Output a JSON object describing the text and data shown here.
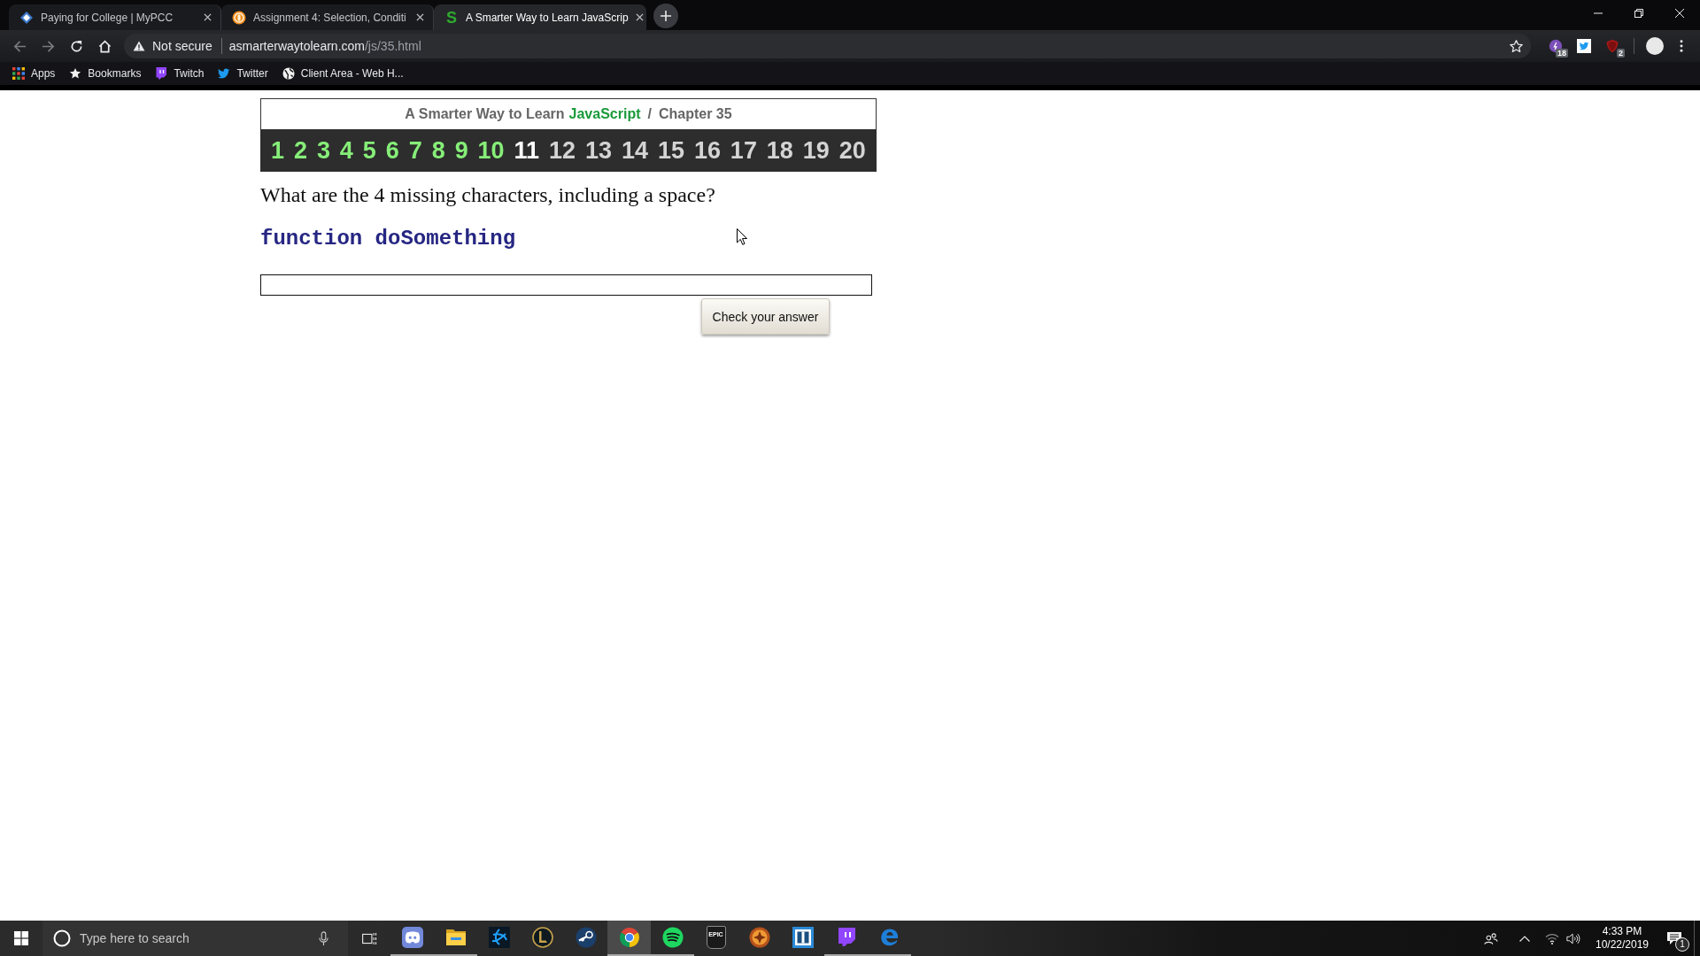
{
  "browser": {
    "tabs": [
      {
        "kind": "diamond",
        "title": "Paying for College | MyPCC",
        "selected": false
      },
      {
        "kind": "medal",
        "title": "Assignment 4: Selection, Conditi",
        "selected": false
      },
      {
        "kind": "letter",
        "icon_text": "S",
        "title": "A Smarter Way to Learn JavaScrip",
        "selected": true
      }
    ],
    "toolbar": {
      "back_disabled": true,
      "forward_disabled": true
    },
    "address_bar": {
      "security_label": "Not secure",
      "host": "asmarterwaytolearn.com",
      "path": "/js/35.html",
      "bookmarked": false
    },
    "extensions": [
      {
        "kind": "orb",
        "badge": "18"
      },
      {
        "kind": "bird"
      },
      {
        "kind": "shield",
        "badge": "2"
      }
    ],
    "bookmarks": [
      {
        "kind": "apps",
        "label": "Apps"
      },
      {
        "kind": "star",
        "label": "Bookmarks"
      },
      {
        "kind": "bubble",
        "label": "Twitch"
      },
      {
        "kind": "bird",
        "label": "Twitter"
      },
      {
        "kind": "globe",
        "label": "Client Area - Web H..."
      }
    ]
  },
  "page": {
    "site_title": {
      "prefix": "A Smarter Way to Learn",
      "highlight": "JavaScript",
      "separator": "/",
      "chapter": "Chapter 35"
    },
    "exercises": [
      {
        "label": "1",
        "done": true,
        "selected": false
      },
      {
        "label": "2",
        "done": true,
        "selected": false
      },
      {
        "label": "3",
        "done": true,
        "selected": false
      },
      {
        "label": "4",
        "done": true,
        "selected": false
      },
      {
        "label": "5",
        "done": true,
        "selected": false
      },
      {
        "label": "6",
        "done": true,
        "selected": false
      },
      {
        "label": "7",
        "done": true,
        "selected": false
      },
      {
        "label": "8",
        "done": true,
        "selected": false
      },
      {
        "label": "9",
        "done": true,
        "selected": false
      },
      {
        "label": "10",
        "done": true,
        "selected": false
      },
      {
        "label": "11",
        "done": false,
        "selected": true
      },
      {
        "label": "12",
        "done": false,
        "selected": false
      },
      {
        "label": "13",
        "done": false,
        "selected": false
      },
      {
        "label": "14",
        "done": false,
        "selected": false
      },
      {
        "label": "15",
        "done": false,
        "selected": false
      },
      {
        "label": "16",
        "done": false,
        "selected": false
      },
      {
        "label": "17",
        "done": false,
        "selected": false
      },
      {
        "label": "18",
        "done": false,
        "selected": false
      },
      {
        "label": "19",
        "done": false,
        "selected": false
      },
      {
        "label": "20",
        "done": false,
        "selected": false
      }
    ],
    "question": "What are the 4 missing characters, including a space?",
    "code": "function doSomething",
    "submit_button": "Check your answer"
  },
  "taskbar": {
    "search_placeholder": "Type here to search",
    "apps": [
      {
        "kind": "face",
        "running": true,
        "selected": false
      },
      {
        "kind": "folder",
        "running": true,
        "selected": false
      },
      {
        "kind": "swirl",
        "running": false,
        "selected": false
      },
      {
        "kind": "emblem",
        "running": false,
        "selected": false
      },
      {
        "kind": "wheel",
        "running": false,
        "selected": false
      },
      {
        "kind": "segments",
        "running": true,
        "selected": true
      },
      {
        "kind": "waves",
        "running": true,
        "selected": false
      },
      {
        "kind": "tile",
        "label": "EPIC",
        "running": false,
        "selected": false
      },
      {
        "kind": "medal",
        "running": false,
        "selected": false
      },
      {
        "kind": "bracket",
        "running": false,
        "selected": false
      },
      {
        "kind": "bubble",
        "running": true,
        "selected": false
      },
      {
        "kind": "swoosh",
        "running": true,
        "selected": false
      }
    ],
    "clock": {
      "time": "4:33 PM",
      "date": "10/22/2019"
    },
    "notification_badge": "1"
  }
}
